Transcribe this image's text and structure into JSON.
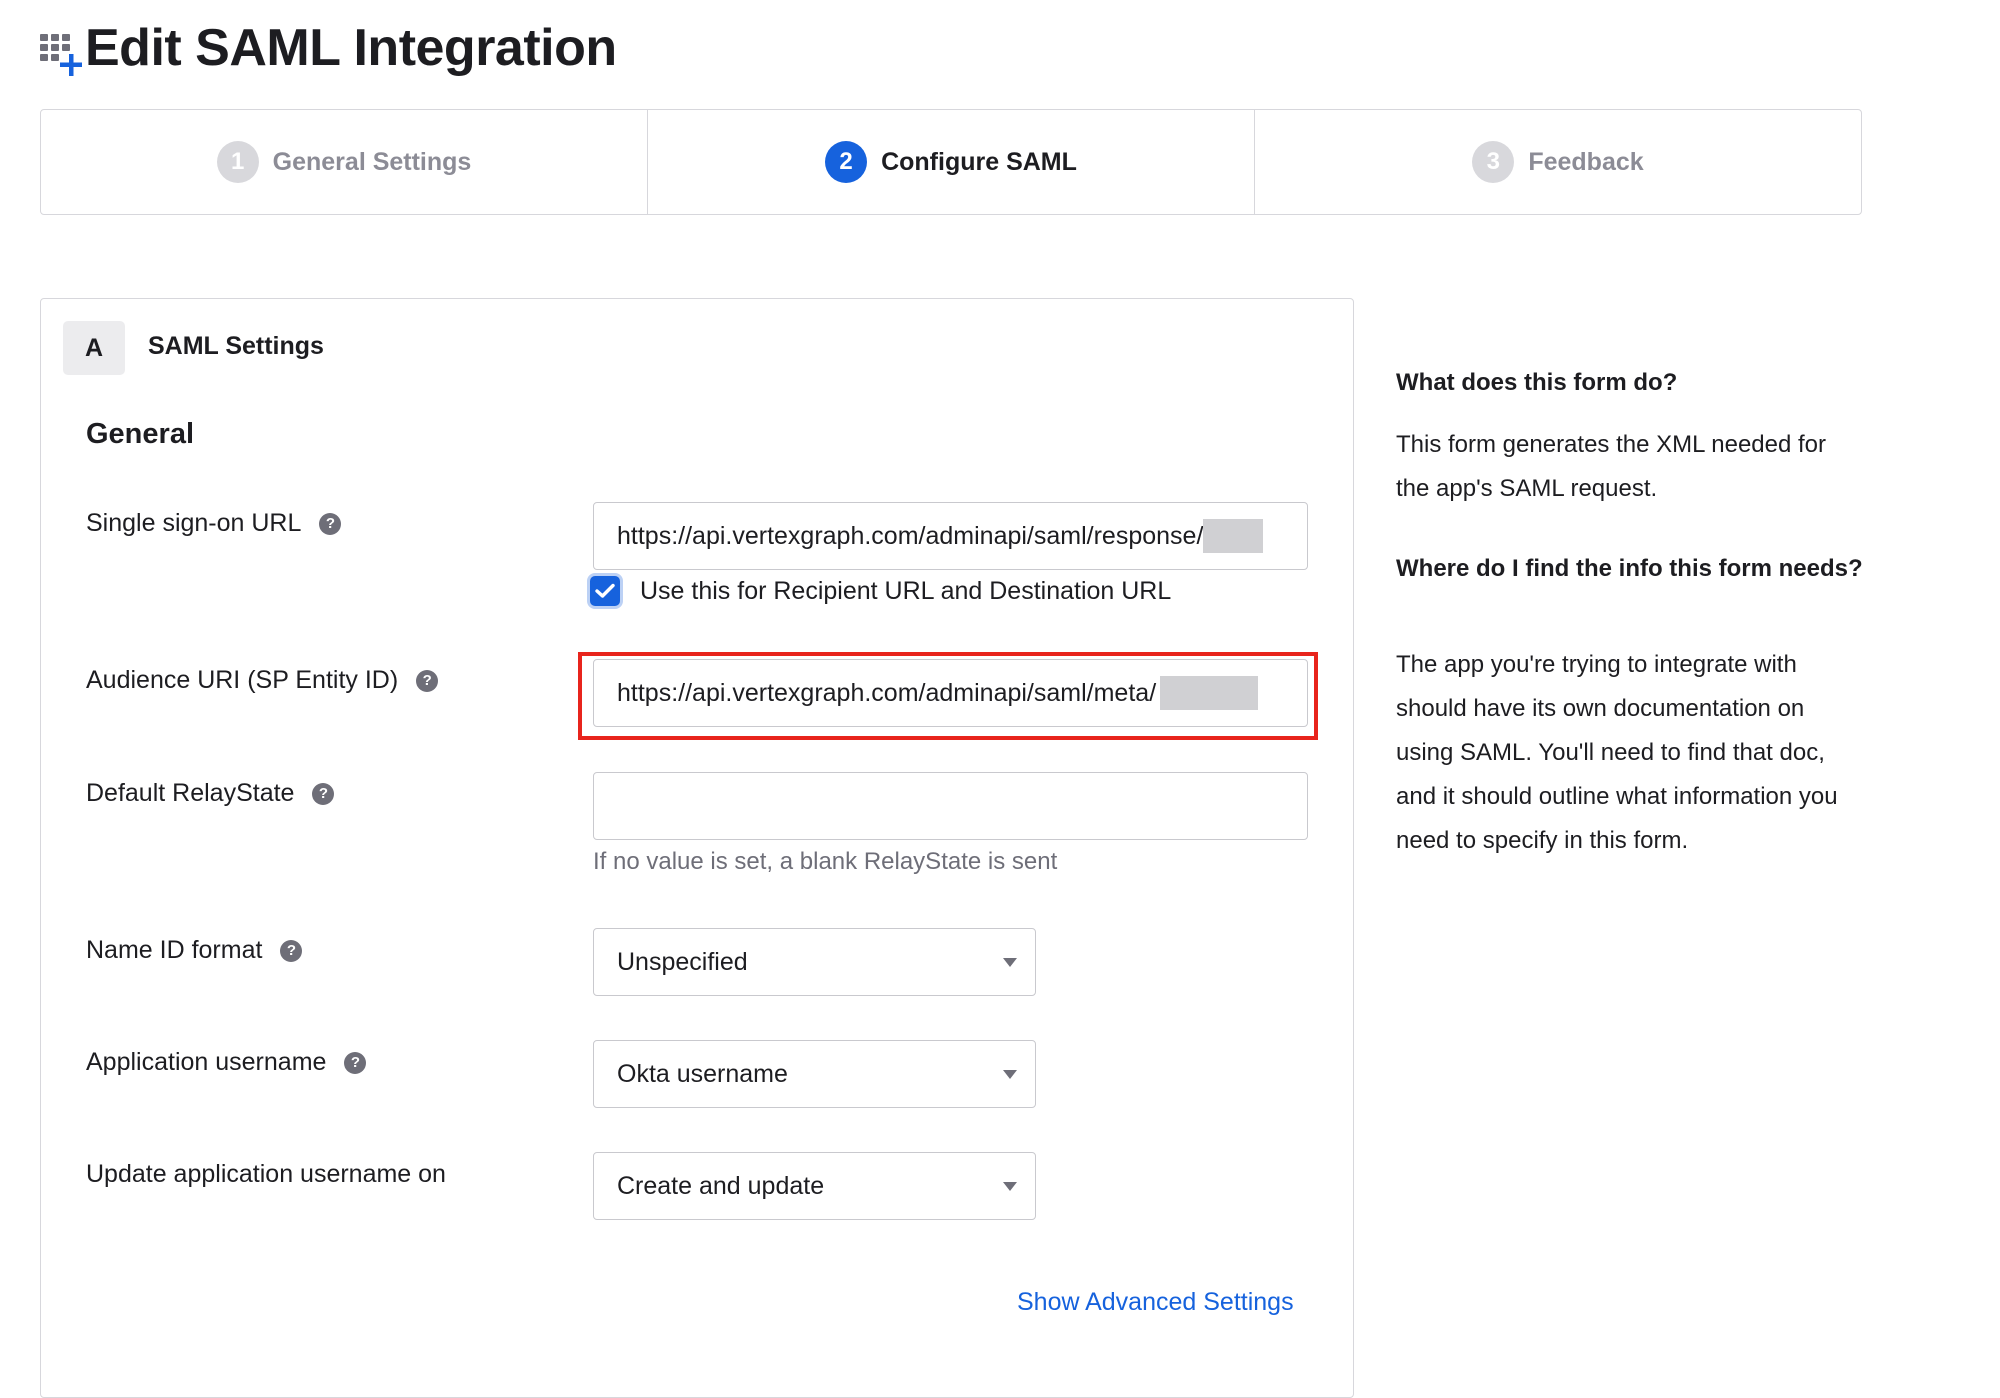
{
  "header": {
    "title": "Edit SAML Integration",
    "icon": "app-grid-add-icon"
  },
  "stepper": {
    "steps": [
      {
        "number": "1",
        "label": "General Settings",
        "state": "inactive"
      },
      {
        "number": "2",
        "label": "Configure SAML",
        "state": "active"
      },
      {
        "number": "3",
        "label": "Feedback",
        "state": "inactive"
      }
    ]
  },
  "section": {
    "badge": "A",
    "title": "SAML Settings"
  },
  "general": {
    "title": "General",
    "sso_url": {
      "label": "Single sign-on URL",
      "value": "https://api.vertexgraph.com/adminapi/saml/response/"
    },
    "recipient_checkbox": {
      "label": "Use this for Recipient URL and Destination URL",
      "checked": true
    },
    "audience_uri": {
      "label": "Audience URI (SP Entity ID)",
      "value": "https://api.vertexgraph.com/adminapi/saml/meta/"
    },
    "relay_state": {
      "label": "Default RelayState",
      "value": "",
      "hint": "If no value is set, a blank RelayState is sent"
    },
    "name_id_format": {
      "label": "Name ID format",
      "value": "Unspecified"
    },
    "app_username": {
      "label": "Application username",
      "value": "Okta username"
    },
    "update_username": {
      "label": "Update application username on",
      "value": "Create and update"
    },
    "advanced_link": "Show Advanced Settings"
  },
  "help_panel": {
    "q1": "What does this form do?",
    "a1": "This form generates the XML needed for the app's SAML request.",
    "q2": "Where do I find the info this form needs?",
    "a2": "The app you're trying to integrate with should have its own documentation on using SAML. You'll need to find that doc, and it should outline what information you need to specify in this form."
  },
  "colors": {
    "accent": "#1662dd",
    "highlight": "#e8241c",
    "border": "#d7d7dc",
    "muted": "#6e6e78"
  }
}
